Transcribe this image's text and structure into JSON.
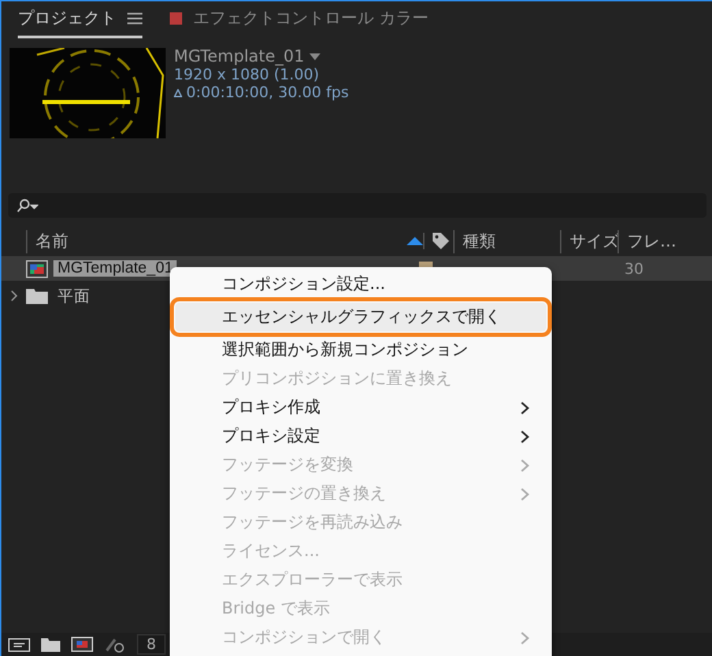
{
  "tabs": [
    {
      "label": "プロジェクト",
      "selected": true,
      "kind": "menu"
    },
    {
      "label": "エフェクトコントロール カラー",
      "selected": false,
      "kind": "swatch",
      "color": "#b83a3a"
    }
  ],
  "preview": {
    "name": "MGTemplate_01",
    "resolution": "1920 x 1080 (1.00)",
    "duration": "0:00:10:00, 30.00 fps"
  },
  "table": {
    "columns": [
      {
        "label": "名前",
        "sorted": true
      },
      {
        "kind": "tag"
      },
      {
        "label": "種類"
      },
      {
        "label": "サイズ"
      },
      {
        "label": "フレ…"
      }
    ],
    "rows": [
      {
        "kind": "composition",
        "name": "MGTemplate_01",
        "selected": true,
        "color": "#b8a07a",
        "frames": "30"
      },
      {
        "kind": "folder",
        "name": "平面",
        "selected": false
      }
    ]
  },
  "context_menu": {
    "items": [
      {
        "label": "コンポジション設定...",
        "disabled": false,
        "submenu": false,
        "highlighted": false
      },
      {
        "label": "エッセンシャルグラフィックスで開く",
        "disabled": false,
        "submenu": false,
        "highlighted": true
      },
      {
        "label": "選択範囲から新規コンポジション",
        "disabled": false,
        "submenu": false,
        "highlighted": false
      },
      {
        "label": "プリコンポジションに置き換え",
        "disabled": true,
        "submenu": false,
        "highlighted": false
      },
      {
        "label": "プロキシ作成",
        "disabled": false,
        "submenu": true,
        "highlighted": false
      },
      {
        "label": "プロキシ設定",
        "disabled": false,
        "submenu": true,
        "highlighted": false
      },
      {
        "label": "フッテージを変換",
        "disabled": true,
        "submenu": true,
        "highlighted": false
      },
      {
        "label": "フッテージの置き換え",
        "disabled": true,
        "submenu": true,
        "highlighted": false
      },
      {
        "label": "フッテージを再読み込み",
        "disabled": true,
        "submenu": false,
        "highlighted": false
      },
      {
        "label": "ライセンス...",
        "disabled": true,
        "submenu": false,
        "highlighted": false
      },
      {
        "label": "エクスプローラーで表示",
        "disabled": true,
        "submenu": false,
        "highlighted": false
      },
      {
        "label": "Bridge で表示",
        "disabled": true,
        "submenu": false,
        "highlighted": false
      },
      {
        "label": "コンポジションで開く",
        "disabled": true,
        "submenu": true,
        "highlighted": false
      }
    ]
  },
  "footer": {
    "bit_depth": "8"
  }
}
